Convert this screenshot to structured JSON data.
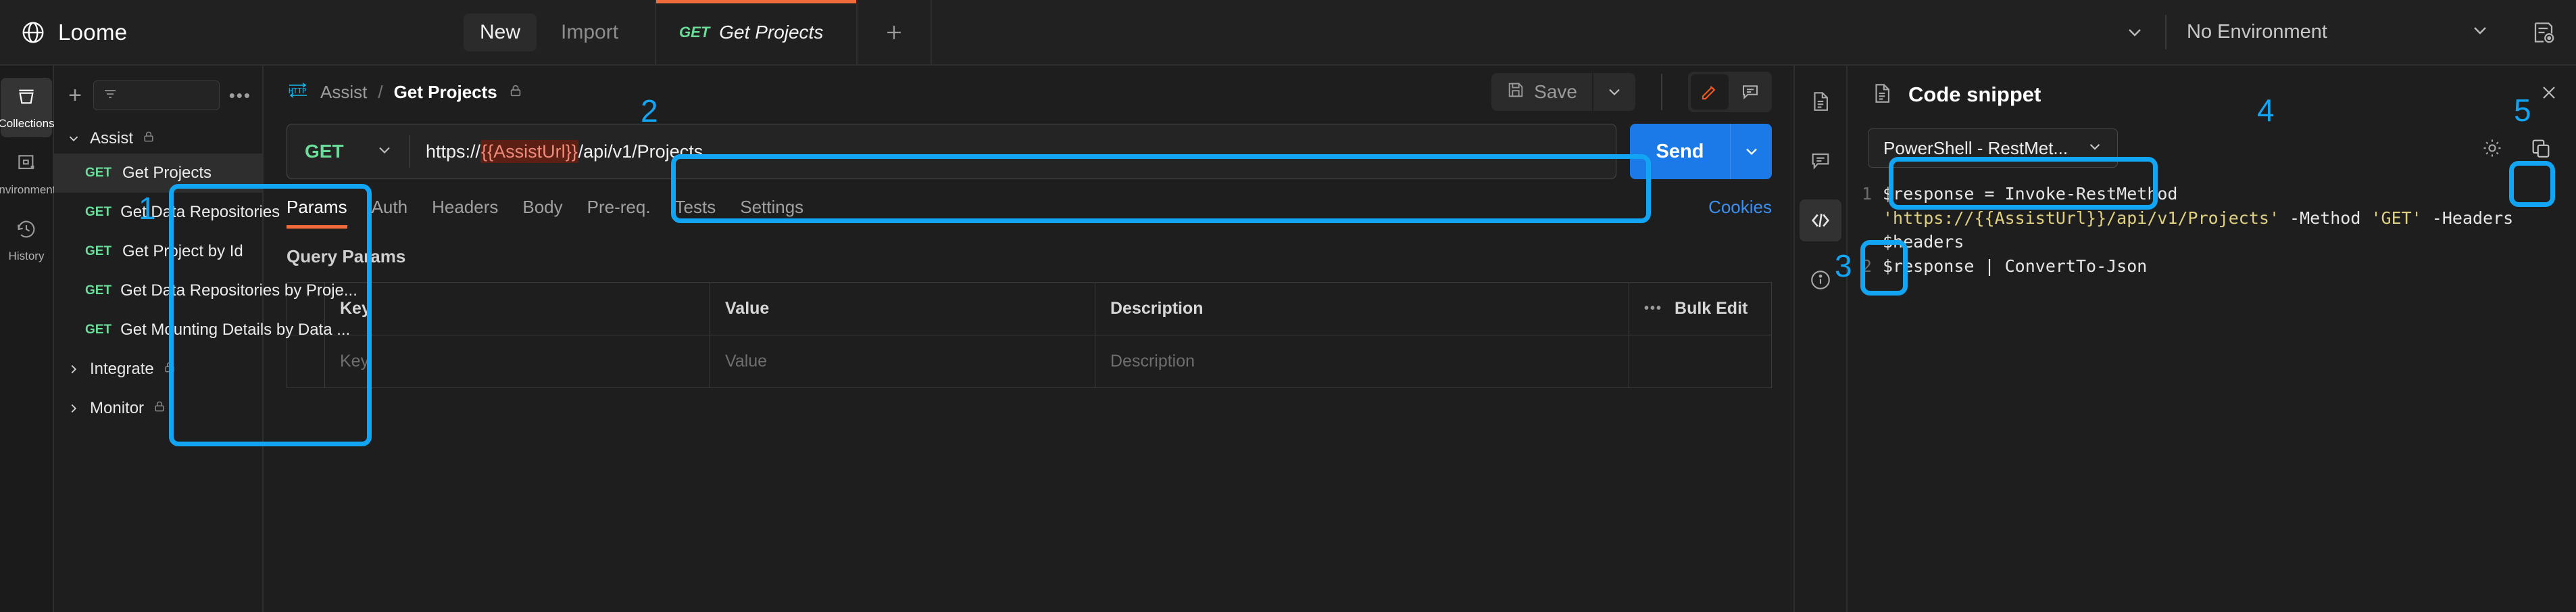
{
  "app": {
    "brand": "Loome",
    "brand_icon": "globe-icon"
  },
  "topbar": {
    "new_label": "New",
    "import_label": "Import",
    "tabs": [
      {
        "method": "GET",
        "label": "Get Projects",
        "active": true
      }
    ],
    "add_tab_icon": "plus-icon",
    "tabs_caret_icon": "chevron-down-icon",
    "environment": {
      "selected": "No Environment",
      "caret_icon": "chevron-down-icon",
      "side_icon": "environment-quick-look-icon"
    }
  },
  "rail": {
    "items": [
      {
        "label": "Collections",
        "icon": "collection-icon",
        "active": true
      },
      {
        "label": "Environments",
        "icon": "environments-icon",
        "active": false
      },
      {
        "label": "History",
        "icon": "history-icon",
        "active": false
      }
    ]
  },
  "sidebar": {
    "add_icon": "plus-icon",
    "filter_icon": "filter-icon",
    "search_placeholder": "",
    "more_icon": "more-horizontal-icon",
    "tree": [
      {
        "label": "Assist",
        "expanded": true,
        "lock_icon": "lock-icon",
        "requests": [
          {
            "method": "GET",
            "name": "Get Projects",
            "selected": true
          },
          {
            "method": "GET",
            "name": "Get Data Repositories",
            "selected": false
          },
          {
            "method": "GET",
            "name": "Get Project by Id",
            "selected": false
          },
          {
            "method": "GET",
            "name": "Get Data Repositories by Proje...",
            "selected": false
          },
          {
            "method": "GET",
            "name": "Get Mounting Details by Data ...",
            "selected": false
          }
        ]
      },
      {
        "label": "Integrate",
        "expanded": false,
        "lock_icon": "lock-icon",
        "requests": []
      },
      {
        "label": "Monitor",
        "expanded": false,
        "lock_icon": "lock-icon",
        "requests": []
      }
    ]
  },
  "main": {
    "breadcrumb": {
      "protocol_icon": "http-icon",
      "collection": "Assist",
      "separator": "/",
      "request": "Get Projects",
      "lock_icon": "lock-icon"
    },
    "save": {
      "label": "Save",
      "icon": "save-icon",
      "caret_icon": "chevron-down-icon"
    },
    "view_modes": [
      {
        "icon": "pencil-icon",
        "active": true
      },
      {
        "icon": "comment-icon",
        "active": false
      }
    ],
    "request": {
      "method": "GET",
      "method_caret_icon": "chevron-down-icon",
      "url_prefix": "https://",
      "url_variable": "{{AssistUrl}}",
      "url_suffix": "/api/v1/Projects",
      "send_label": "Send",
      "send_caret_icon": "chevron-down-icon"
    },
    "tabs": [
      {
        "label": "Params",
        "active": true
      },
      {
        "label": "Auth",
        "active": false
      },
      {
        "label": "Headers",
        "active": false
      },
      {
        "label": "Body",
        "active": false
      },
      {
        "label": "Pre-req.",
        "active": false
      },
      {
        "label": "Tests",
        "active": false
      },
      {
        "label": "Settings",
        "active": false
      }
    ],
    "cookies_label": "Cookies",
    "query_params": {
      "title": "Query Params",
      "columns": [
        "Key",
        "Value",
        "Description"
      ],
      "bulk_edit_label": "Bulk Edit",
      "bulk_dots_icon": "more-horizontal-icon",
      "empty_row": {
        "key": "Key",
        "value": "Value",
        "description": "Description"
      }
    }
  },
  "icon_rail": [
    {
      "icon": "document-icon",
      "active": false
    },
    {
      "icon": "comment-icon",
      "active": false
    },
    {
      "icon": "code-icon",
      "active": true
    },
    {
      "icon": "info-icon",
      "active": false
    }
  ],
  "code_panel": {
    "header_icon": "document-icon",
    "title": "Code snippet",
    "close_icon": "close-icon",
    "language": "PowerShell - RestMet...",
    "language_caret_icon": "chevron-down-icon",
    "settings_icon": "gear-icon",
    "copy_icon": "copy-icon",
    "lines": [
      {
        "num": "1",
        "segments": [
          {
            "t": "$response = Invoke-RestMethod ",
            "k": "plain"
          },
          {
            "t": "'https://{{AssistUrl}}/api/v1/Projects'",
            "k": "string"
          },
          {
            "t": " -Method ",
            "k": "plain"
          },
          {
            "t": "'GET'",
            "k": "string"
          },
          {
            "t": " -Headers $headers",
            "k": "plain"
          }
        ]
      },
      {
        "num": "2",
        "segments": [
          {
            "t": "$response | ConvertTo-Json",
            "k": "plain"
          }
        ]
      }
    ]
  },
  "annotations": {
    "accent": "#12a5f4",
    "markers": [
      {
        "n": "1",
        "target": "sidebar-request-list"
      },
      {
        "n": "2",
        "target": "breadcrumb"
      },
      {
        "n": "3",
        "target": "code-icon-rail-button"
      },
      {
        "n": "4",
        "target": "language-select"
      },
      {
        "n": "5",
        "target": "copy-button"
      }
    ]
  }
}
